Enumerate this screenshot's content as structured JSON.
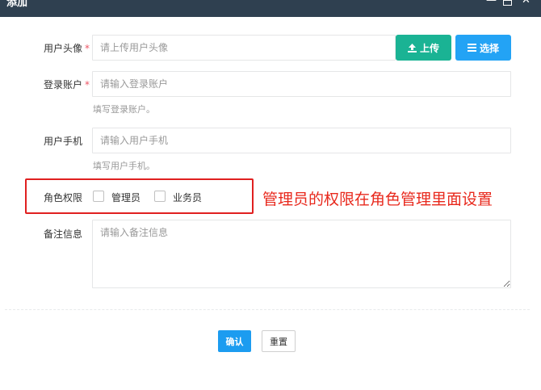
{
  "window": {
    "title": "添加",
    "minimize_glyph": "—",
    "close_glyph": "✕"
  },
  "form": {
    "avatar": {
      "label": "用户头像",
      "required_mark": "*",
      "placeholder": "请上传用户头像",
      "upload_label": "上传",
      "select_label": "选择"
    },
    "account": {
      "label": "登录账户",
      "required_mark": "*",
      "placeholder": "请输入登录账户",
      "hint": "填写登录账户。"
    },
    "phone": {
      "label": "用户手机",
      "placeholder": "请输入用户手机",
      "hint": "填写用户手机。"
    },
    "role": {
      "label": "角色权限",
      "options": [
        "管理员",
        "业务员"
      ]
    },
    "remark": {
      "label": "备注信息",
      "placeholder": "请输入备注信息"
    }
  },
  "annotation": "管理员的权限在角色管理里面设置",
  "actions": {
    "confirm_label": "确认",
    "reset_label": "重置"
  },
  "colors": {
    "titlebar": "#2f4050",
    "upload_button": "#1ab394",
    "select_button": "#23a3f5",
    "confirm_button": "#1c9cf0",
    "annotation_red": "#e8281c"
  }
}
